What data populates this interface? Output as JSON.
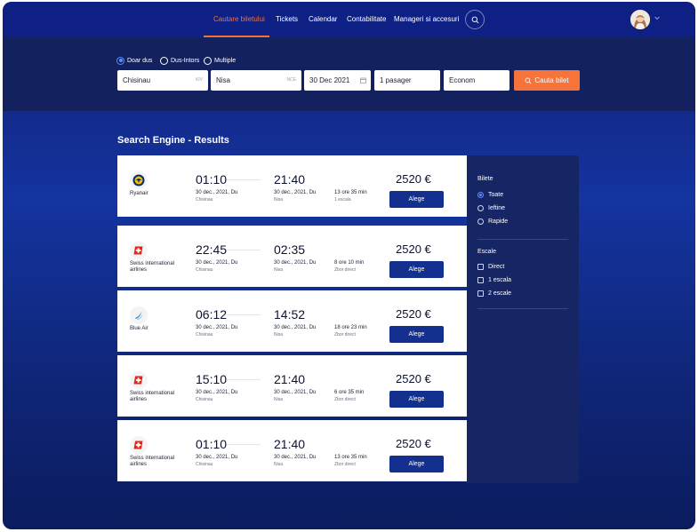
{
  "nav": {
    "items": [
      "Cautare biletului",
      "Tickets",
      "Calendar",
      "Contabilitate",
      "Manageri si accesuri"
    ],
    "active_index": 0
  },
  "search": {
    "trip_types": [
      "Doar dus",
      "Dus-Intors",
      "Multiple"
    ],
    "selected_trip_type": "Doar dus",
    "from": {
      "value": "Chisinau",
      "code": "KIV"
    },
    "to": {
      "value": "Nisa",
      "code": "NCE"
    },
    "date": "30 Dec 2021",
    "passengers": "1 pasager",
    "class": "Econom",
    "button_label": "Cauta bilet"
  },
  "results_title": "Search Engine - Results",
  "results": [
    {
      "airline": "Ryanair",
      "logo": "ryanair-logo",
      "dep_time": "01:10",
      "arr_time": "21:40",
      "dep_date": "30 dec., 2021, Du",
      "arr_date": "30 dec., 2021, Du",
      "dep_city": "Chisinau",
      "arr_city": "Nisa",
      "duration": "13 ore 35 min",
      "stops": "1 escala",
      "price": "2520 €",
      "button": "Alege"
    },
    {
      "airline": "Swiss international airlines",
      "logo": "swiss-logo",
      "dep_time": "22:45",
      "arr_time": "02:35",
      "dep_date": "30 dec., 2021, Du",
      "arr_date": "30 dec., 2021, Du",
      "dep_city": "Chisinau",
      "arr_city": "Nisa",
      "duration": "8 ore 10 min",
      "stops": "Zbor direct",
      "price": "2520 €",
      "button": "Alege"
    },
    {
      "airline": "Blue Air",
      "logo": "blue-air-logo",
      "dep_time": "06:12",
      "arr_time": "14:52",
      "dep_date": "30 dec., 2021, Du",
      "arr_date": "30 dec., 2021, Du",
      "dep_city": "Chisinau",
      "arr_city": "Nisa",
      "duration": "18 ore 23 min",
      "stops": "Zbor direct",
      "price": "2520 €",
      "button": "Alege"
    },
    {
      "airline": "Swiss international airlines",
      "logo": "swiss-logo",
      "dep_time": "15:10",
      "arr_time": "21:40",
      "dep_date": "30 dec., 2021, Du",
      "arr_date": "30 dec., 2021, Du",
      "dep_city": "Chisinau",
      "arr_city": "Nisa",
      "duration": "6 ore 35 min",
      "stops": "Zbor direct",
      "price": "2520 €",
      "button": "Alege"
    },
    {
      "airline": "Swiss international airlines",
      "logo": "swiss-logo",
      "dep_time": "01:10",
      "arr_time": "21:40",
      "dep_date": "30 dec., 2021, Du",
      "arr_date": "30 dec., 2021, Du",
      "dep_city": "Chisinau",
      "arr_city": "Nisa",
      "duration": "13 ore 35 min",
      "stops": "Zbor direct",
      "price": "2520 €",
      "button": "Alege"
    }
  ],
  "filters": {
    "tickets": {
      "title": "Bilete",
      "options": [
        "Toate",
        "Ieftine",
        "Rapide"
      ],
      "selected": "Toate"
    },
    "stops": {
      "title": "Escale",
      "options": [
        "Direct",
        "1 escala",
        "2 escale"
      ]
    }
  },
  "colors": {
    "accent": "#f0713a",
    "primary": "#14308f",
    "nav_bg": "#0e2083",
    "band_bg": "#13225e"
  }
}
